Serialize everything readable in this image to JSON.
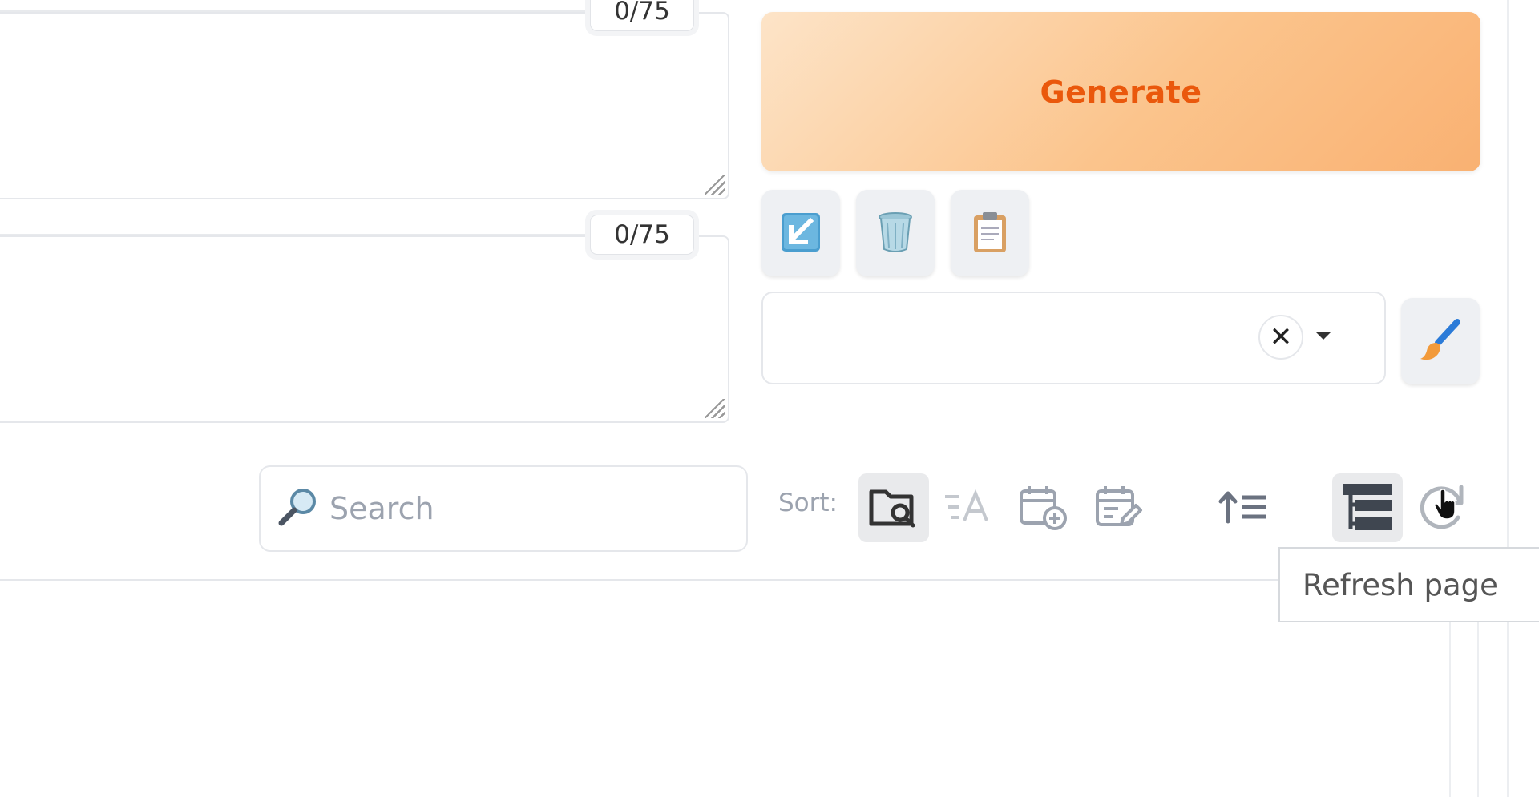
{
  "prompts": {
    "positive": {
      "value": "",
      "token_count": "0/75"
    },
    "negative": {
      "value": "",
      "token_count": "0/75"
    }
  },
  "actions": {
    "generate_label": "Generate",
    "tools": [
      {
        "icon": "arrow-down-left-icon"
      },
      {
        "icon": "trash-icon"
      },
      {
        "icon": "clipboard-icon"
      }
    ]
  },
  "styles": {
    "selected": "",
    "clear_symbol": "✕",
    "apply_icon": "paintbrush-icon"
  },
  "extra_networks": {
    "search": {
      "placeholder": "Search",
      "value": "",
      "icon": "magnifier-icon"
    },
    "sort_label": "Sort:",
    "sort_buttons": [
      {
        "icon": "folder-search-icon",
        "active": true
      },
      {
        "icon": "sort-alpha-icon",
        "active": false
      },
      {
        "icon": "calendar-add-icon",
        "active": false
      },
      {
        "icon": "calendar-edit-icon",
        "active": false
      },
      {
        "icon": "sort-ascending-icon",
        "active": false
      },
      {
        "icon": "tree-view-icon",
        "active": true
      },
      {
        "icon": "refresh-icon",
        "active": false
      }
    ],
    "tooltip": "Refresh page"
  },
  "colors": {
    "accent": "#ea580c",
    "generate_gradient_start": "#fde4c8",
    "generate_gradient_end": "#f9b172"
  }
}
